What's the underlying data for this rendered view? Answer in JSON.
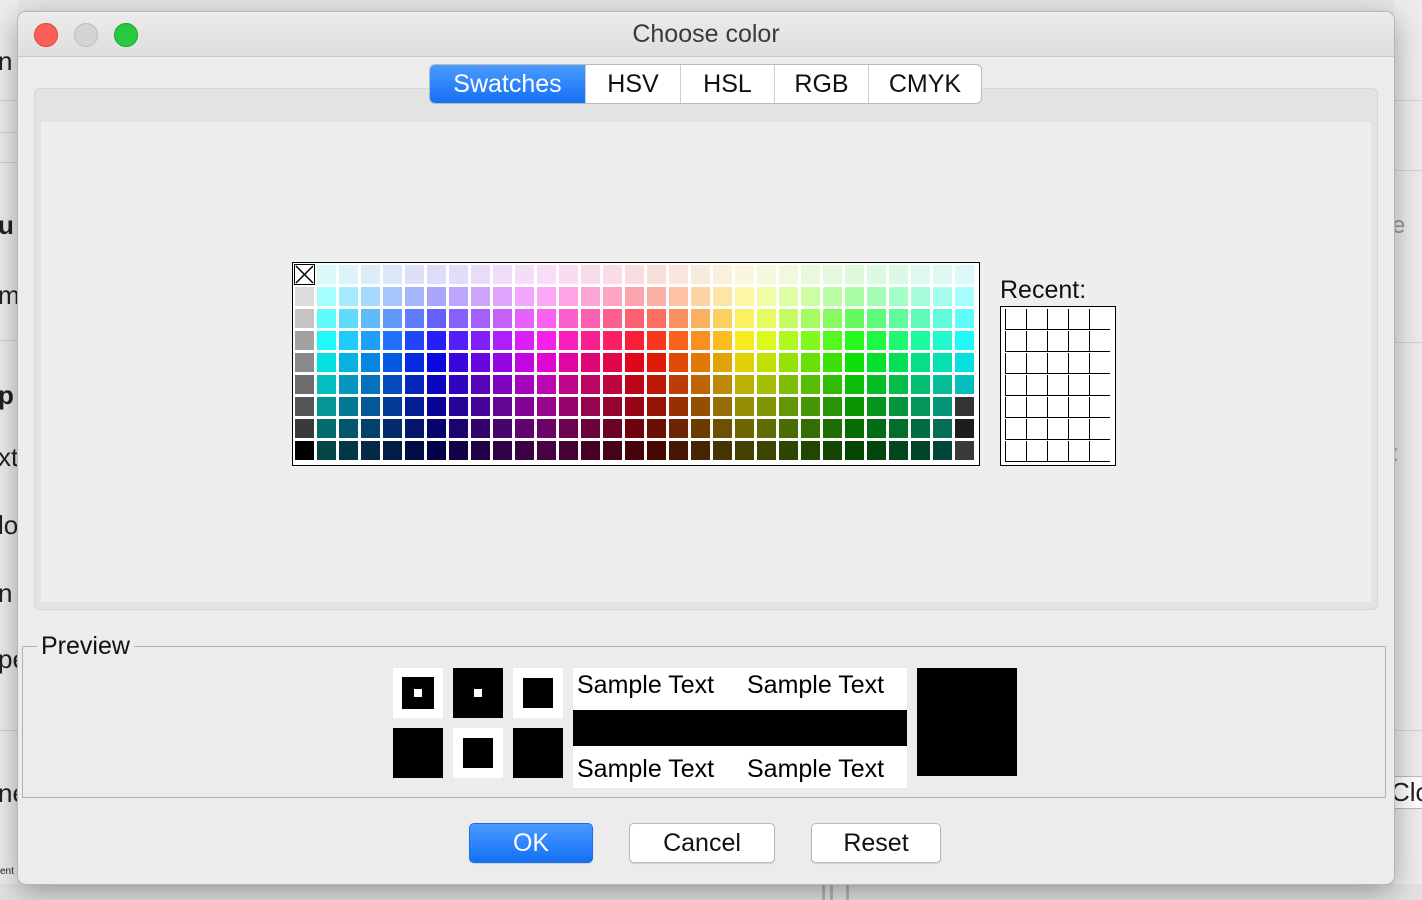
{
  "window": {
    "title": "Choose color"
  },
  "tabs": [
    {
      "label": "Swatches",
      "active": true
    },
    {
      "label": "HSV",
      "active": false
    },
    {
      "label": "HSL",
      "active": false
    },
    {
      "label": "RGB",
      "active": false
    },
    {
      "label": "CMYK",
      "active": false
    }
  ],
  "swatches": {
    "columns": 31,
    "rows": 9
  },
  "recent": {
    "label": "Recent:",
    "columns": 5,
    "rows": 7
  },
  "preview": {
    "legend": "Preview",
    "sample_text": "Sample Text",
    "color": "#000000"
  },
  "buttons": {
    "ok": "OK",
    "cancel": "Cancel",
    "reset": "Reset"
  },
  "background_fragments": {
    "left": [
      "n",
      "u",
      "m",
      "p",
      "xt",
      "lo",
      "n",
      "pe",
      "ne",
      "ent"
    ],
    "right": [
      "e",
      ":",
      "Clo"
    ]
  },
  "colors": {
    "accent": "#1a73f5",
    "window_bg": "#ececec"
  }
}
